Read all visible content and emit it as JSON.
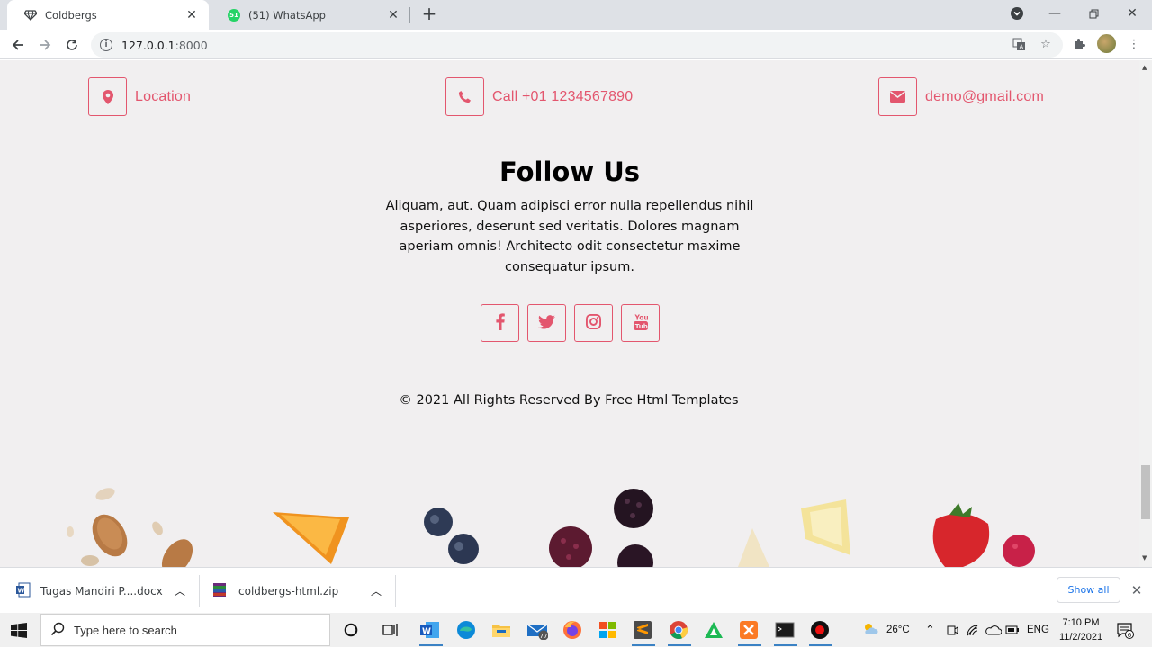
{
  "browser": {
    "tabs": [
      {
        "title": "Coldbergs",
        "active": true,
        "icon": "diamond-icon"
      },
      {
        "title": "(51) WhatsApp",
        "active": false,
        "icon": "whatsapp-icon",
        "badge": "51"
      }
    ],
    "address": {
      "host": "127.0.0.1",
      "port": ":8000"
    }
  },
  "page": {
    "contacts": [
      {
        "text": "Location",
        "icon": "map-marker-icon"
      },
      {
        "text": "Call +01 1234567890",
        "icon": "phone-icon"
      },
      {
        "text": "demo@gmail.com",
        "icon": "envelope-icon"
      }
    ],
    "follow": {
      "title": "Follow Us",
      "text": "Aliquam, aut. Quam adipisci error nulla repellendus nihil asperiores, deserunt sed veritatis. Dolores magnam aperiam omnis! Architecto odit consectetur maxime consequatur ipsum."
    },
    "socials": [
      {
        "icon": "facebook-icon"
      },
      {
        "icon": "twitter-icon"
      },
      {
        "icon": "instagram-icon"
      },
      {
        "icon": "youtube-icon"
      }
    ],
    "copyright": "© 2021 All Rights Reserved By Free Html Templates",
    "accent_color": "#e3566e"
  },
  "downloads": {
    "items": [
      {
        "name": "Tugas  Mandiri P....docx",
        "icon": "word-doc-icon"
      },
      {
        "name": "coldbergs-html.zip",
        "icon": "zip-archive-icon"
      }
    ],
    "show_all": "Show all"
  },
  "taskbar": {
    "search_placeholder": "Type here to search",
    "mail_badge": "77",
    "temperature": "26°C",
    "language": "ENG",
    "time": "7:10 PM",
    "date": "11/2/2021",
    "notification_count": "6"
  }
}
